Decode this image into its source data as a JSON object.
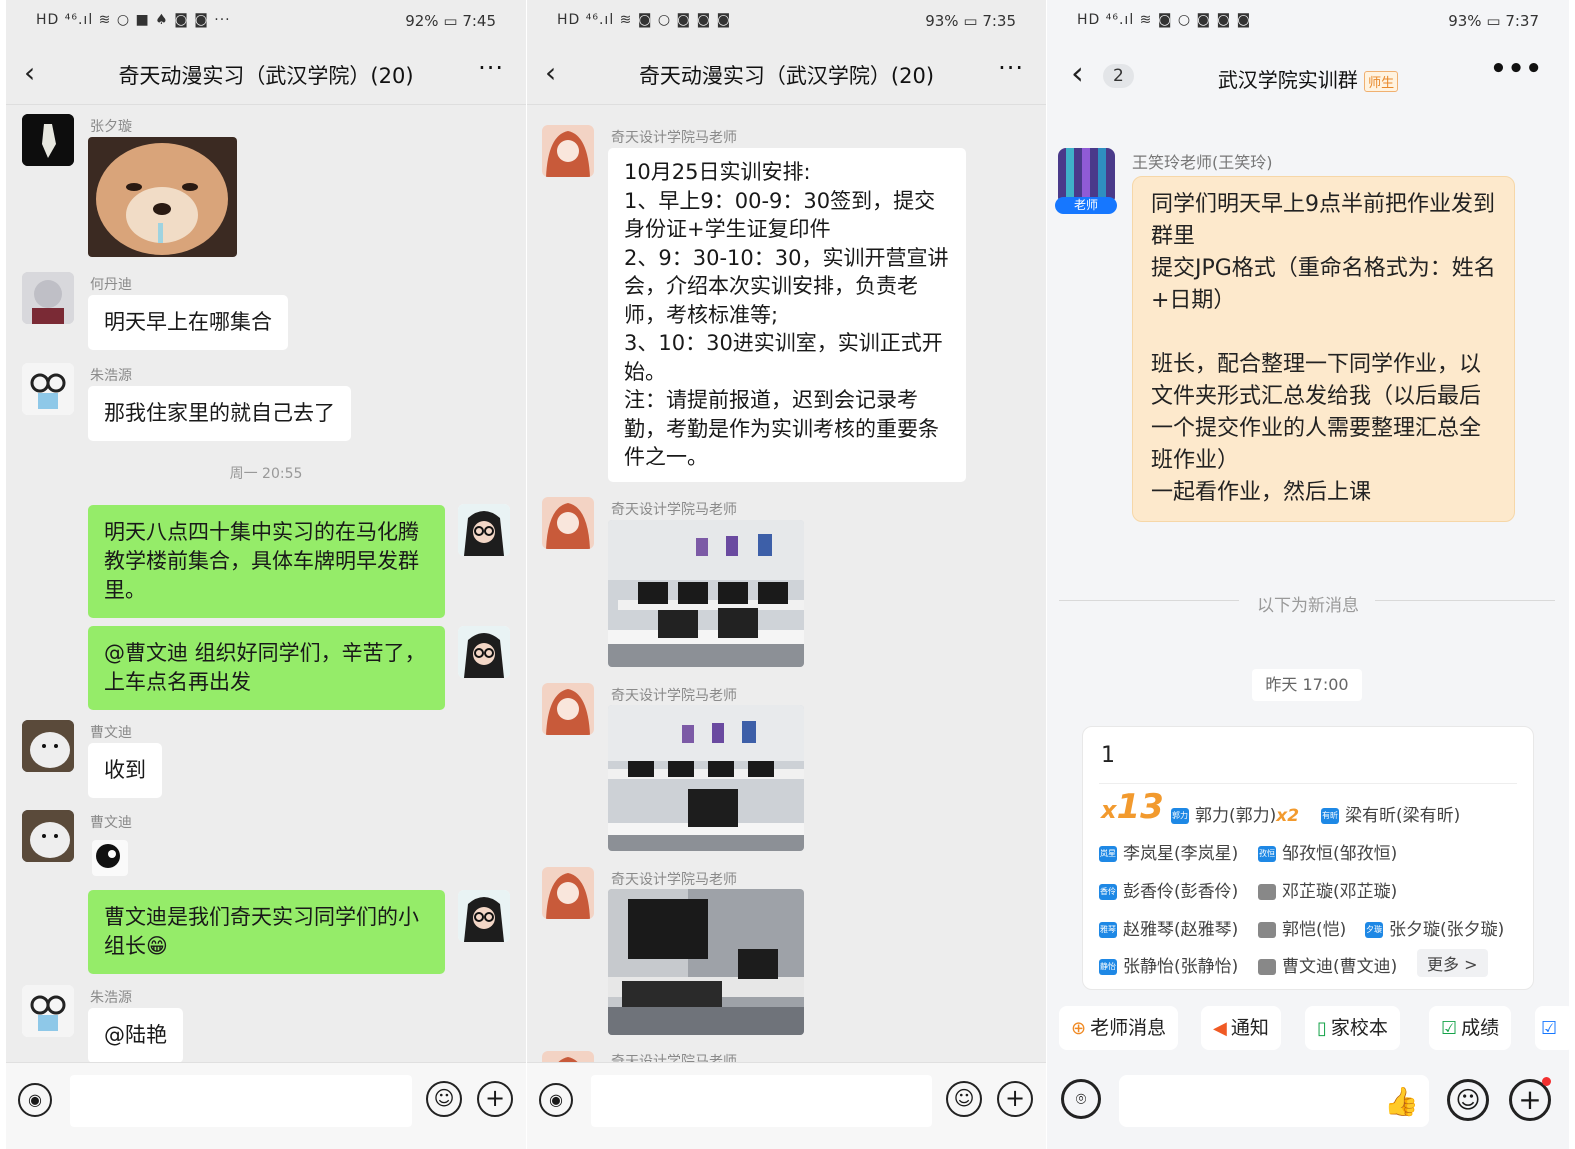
{
  "panel1": {
    "status": {
      "left_icons": "HD ⁴⁶.ıl ≋ ○ ■ ♠ ◙ ◙ ···",
      "battery": "92%",
      "time": "7:45"
    },
    "title": "奇天动漫实习（武汉学院）(20)",
    "messages": [
      {
        "sender": "张夕璇",
        "type": "image"
      },
      {
        "sender": "何丹迪",
        "text": "明天早上在哪集合"
      },
      {
        "sender": "朱浩源",
        "text": "那我住家里的就自己去了"
      },
      {
        "timestamp": "周一 20:55"
      },
      {
        "self": true,
        "text": "明天八点四十集中实习的在马化腾教学楼前集合，具体车牌明早发群里。"
      },
      {
        "self": true,
        "text": "@曹文迪  组织好同学们，辛苦了，上车点名再出发"
      },
      {
        "sender": "曹文迪",
        "text": "收到"
      },
      {
        "sender": "曹文迪",
        "type": "sticker"
      },
      {
        "self": true,
        "text": "曹文迪是我们奇天实习同学们的小组长😁"
      },
      {
        "sender": "朱浩源",
        "text": "@陆艳"
      }
    ]
  },
  "panel2": {
    "status": {
      "left_icons": "HD ⁴⁶.ıl ≋ ◙ ○ ◙ ◙ ◙",
      "battery": "93%",
      "time": "7:35"
    },
    "title": "奇天动漫实习（武汉学院）(20)",
    "sender": "奇天设计学院马老师",
    "notice": "10月25日实训安排:\n1、早上9：00-9：30签到，提交身份证+学生证复印件\n2、9：30-10：30，实训开营宣讲会，介绍本次实训安排，负责老师，考核标准等;\n3、10：30进实训室，实训正式开始。\n注：请提前报道，迟到会记录考勤，考勤是作为实训考核的重要条件之一。"
  },
  "panel3": {
    "status": {
      "left_icons": "HD ⁴⁶.ıl ≋ ◙ ○ ◙ ◙ ◙",
      "battery": "93%",
      "time": "7:37"
    },
    "back_count": "2",
    "title": "武汉学院实训群",
    "role_tag": "师生",
    "sender": "王笑玲老师(王笑玲)",
    "avatar_tag": "老师",
    "teacher_message": "同学们明天早上9点半前把作业发到群里\n提交JPG格式（重命名格式为：姓名+日期）\n\n班长，配合整理一下同学作业，以文件夹形式汇总发给我（以后最后一个提交作业的人需要整理汇总全班作业）\n一起看作业，然后上课",
    "new_messages_label": "以下为新消息",
    "timestamp": "昨天 17:00",
    "card": {
      "number": "1",
      "x_label": "x",
      "count": "13",
      "signers": [
        {
          "name": "郭力(郭力)",
          "icon": "郭力",
          "extra": "x2"
        },
        {
          "name": "梁有昕(梁有昕)",
          "icon": "有昕"
        },
        {
          "name": "李岚星(李岚星)",
          "icon": "岚星"
        },
        {
          "name": "邹孜恒(邹孜恒)",
          "icon": "孜恒"
        },
        {
          "name": "彭香伶(彭香伶)",
          "icon": "香伶"
        },
        {
          "name": "邓芷璇(邓芷璇)",
          "icon": ""
        },
        {
          "name": "赵雅琴(赵雅琴)",
          "icon": "雅琴"
        },
        {
          "name": "郭恺(恺)",
          "icon": ""
        },
        {
          "name": "张夕璇(张夕璇)",
          "icon": "夕璇"
        },
        {
          "name": "张静怡(张静怡)",
          "icon": "静怡"
        },
        {
          "name": "曹文迪(曹文迪)",
          "icon": ""
        }
      ],
      "more": "更多 >"
    },
    "quick_actions": [
      {
        "label": "老师消息",
        "icon": "teacher-icon"
      },
      {
        "label": "通知",
        "icon": "megaphone-icon"
      },
      {
        "label": "家校本",
        "icon": "book-icon"
      },
      {
        "label": "成绩",
        "icon": "grade-icon"
      }
    ]
  }
}
